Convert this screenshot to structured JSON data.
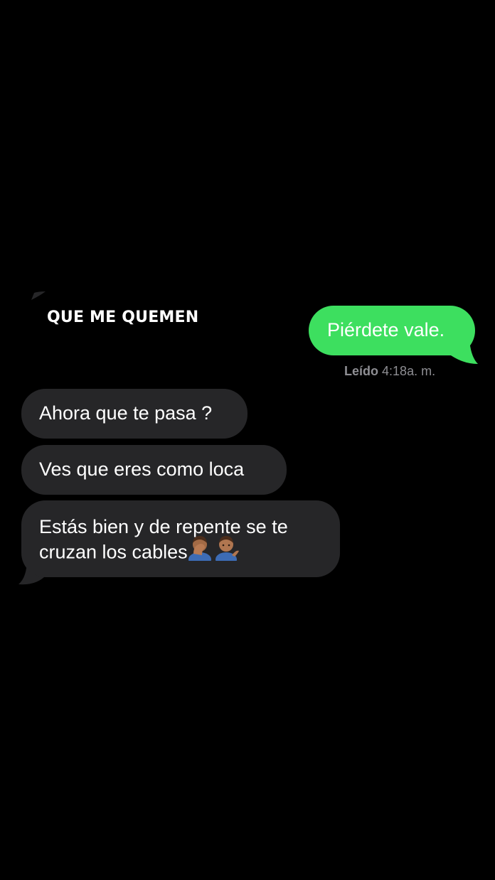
{
  "caption": "QUE ME QUEMEN",
  "colors": {
    "background": "#000000",
    "sent_bubble": "#3ddf5f",
    "received_bubble": "#262628",
    "receipt_text": "#8e8e93",
    "text": "#ffffff"
  },
  "sent_message": {
    "text": "Piérdete vale."
  },
  "read_receipt": {
    "status": "Leído",
    "time": "4:18",
    "period": "a. m."
  },
  "received_messages": [
    {
      "text": "Ahora que te pasa ?"
    },
    {
      "text": "Ves que eres como loca"
    },
    {
      "line1": "Estás bien y de repente se te",
      "line2": "cruzan los cables",
      "emojis": [
        "man-facepalming-emoji",
        "man-tipping-hand-emoji"
      ]
    }
  ]
}
